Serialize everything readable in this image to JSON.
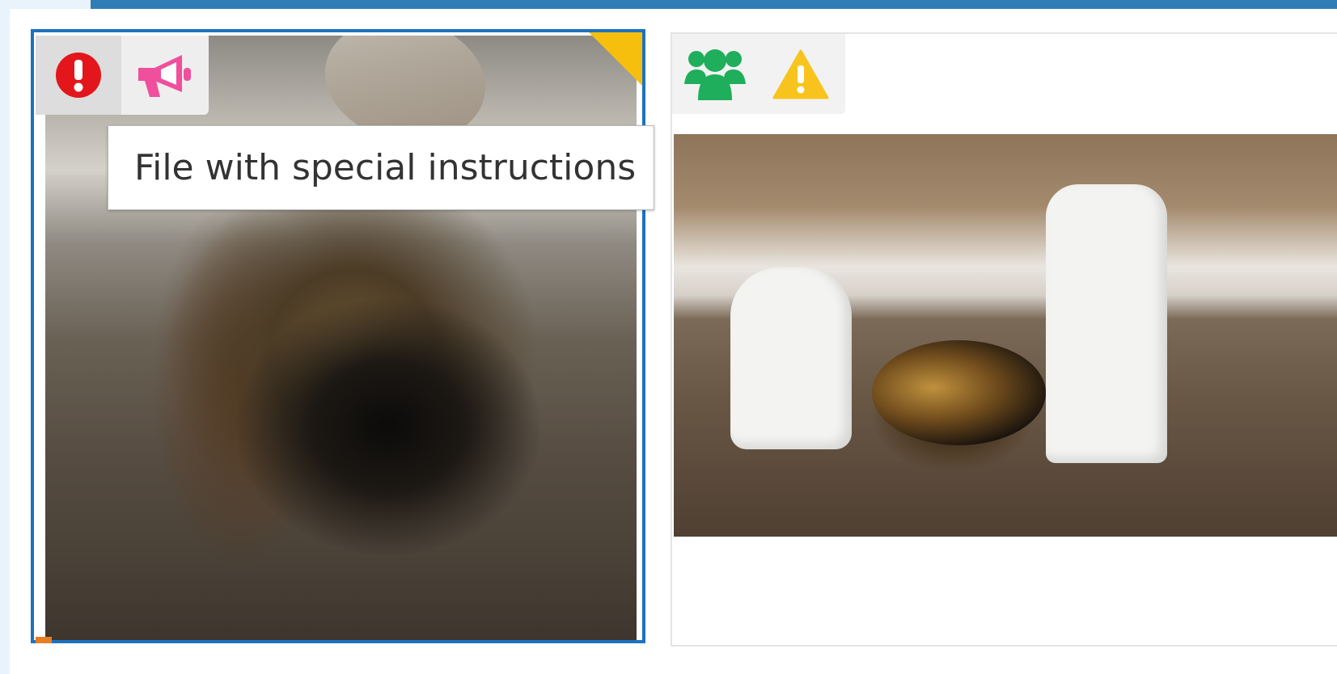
{
  "card1": {
    "status_icons": [
      "exclamation-circle-icon",
      "megaphone-icon"
    ],
    "tooltip": "File with special instructions",
    "colors": {
      "selected_border": "#1d72bf",
      "corner_flag": "#f6bf0e",
      "alert": "#e3161b",
      "megaphone": "#ef4f9c"
    }
  },
  "card2": {
    "status_icons": [
      "users-icon",
      "warning-triangle-icon"
    ],
    "colors": {
      "users": "#1fae5b",
      "warning": "#f8c31c"
    }
  },
  "colors": {
    "top_bar": "#2f7db6"
  }
}
